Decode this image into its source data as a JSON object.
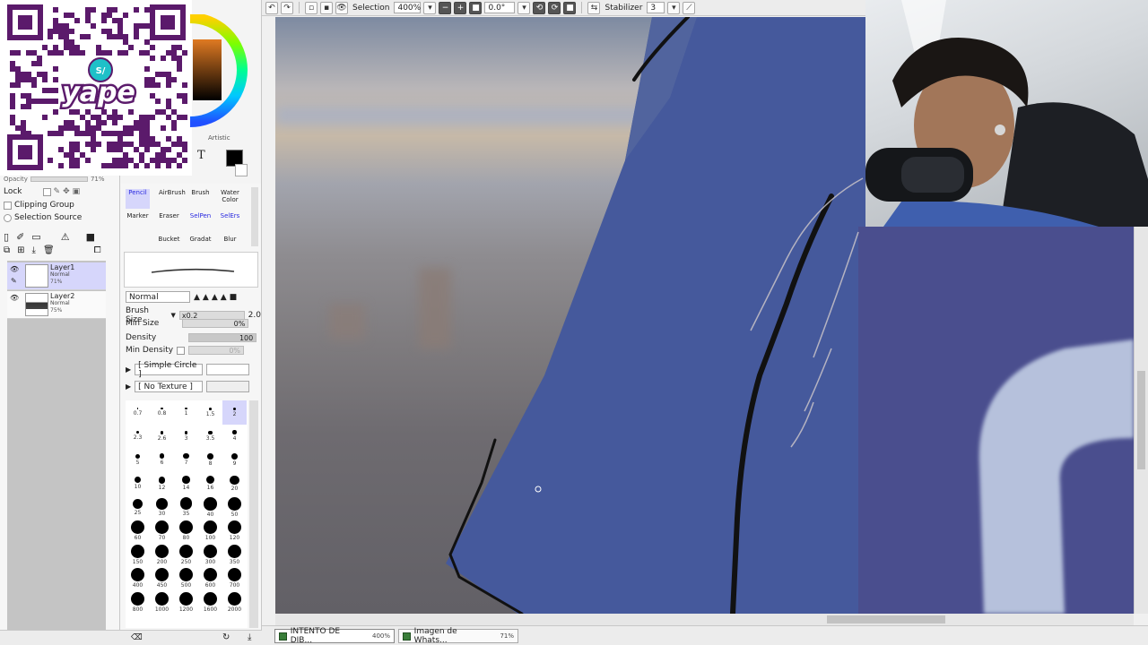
{
  "toolbar": {
    "selection_label": "Selection",
    "zoom_value": "400%",
    "angle_value": "0.0°",
    "stabilizer_label": "Stabilizer",
    "stabilizer_value": "3"
  },
  "color_panel": {
    "tab_label": "Artistic",
    "fg_color": "#000000",
    "bg_color": "#ffffff"
  },
  "qr": {
    "brand_text": "yape",
    "badge_text": "S/",
    "color": "#5b1a6b"
  },
  "layers_panel": {
    "opacity_label": "Opacity",
    "opacity_value": "71%",
    "lock_label": "Lock",
    "clipping_group_label": "Clipping Group",
    "selection_source_label": "Selection Source",
    "layers": [
      {
        "name": "Layer1",
        "mode": "Normal",
        "opacity": "71%",
        "selected": true
      },
      {
        "name": "Layer2",
        "mode": "Normal",
        "opacity": "75%",
        "selected": false
      }
    ]
  },
  "tool_panel": {
    "tools": [
      {
        "label": "Pencil"
      },
      {
        "label": "AirBrush"
      },
      {
        "label": "Brush"
      },
      {
        "label": "Water Color"
      },
      {
        "label": "Marker"
      },
      {
        "label": "Eraser"
      },
      {
        "label": "SelPen"
      },
      {
        "label": "SelErs"
      },
      {
        "label": "Bucket"
      },
      {
        "label": "Gradat"
      },
      {
        "label": "Blur"
      }
    ],
    "blend_mode": "Normal",
    "brush_size_label": "Brush Size",
    "brush_size_mult": "x0.2",
    "brush_size_value": "2.0",
    "min_size_label": "Min Size",
    "min_size_value": "0%",
    "density_label": "Density",
    "density_value": "100",
    "min_density_label": "Min Density",
    "min_density_value": "0%",
    "shape_label": "[ Simple Circle ]",
    "texture_label": "[ No Texture ]",
    "brush_sizes": [
      "0.7",
      "0.8",
      "1",
      "1.5",
      "2",
      "2.3",
      "2.6",
      "3",
      "3.5",
      "4",
      "5",
      "6",
      "7",
      "8",
      "9",
      "10",
      "12",
      "14",
      "16",
      "20",
      "25",
      "30",
      "35",
      "40",
      "50",
      "60",
      "70",
      "80",
      "100",
      "120",
      "150",
      "200",
      "250",
      "300",
      "350",
      "400",
      "450",
      "500",
      "600",
      "700",
      "800",
      "1000",
      "1200",
      "1600",
      "2000"
    ],
    "selected_size": "2"
  },
  "statusbar": {
    "tabs": [
      {
        "name": "INTENTO DE DIB...",
        "zoom": "400%"
      },
      {
        "name": "Imagen de Whats...",
        "zoom": "71%"
      }
    ]
  }
}
